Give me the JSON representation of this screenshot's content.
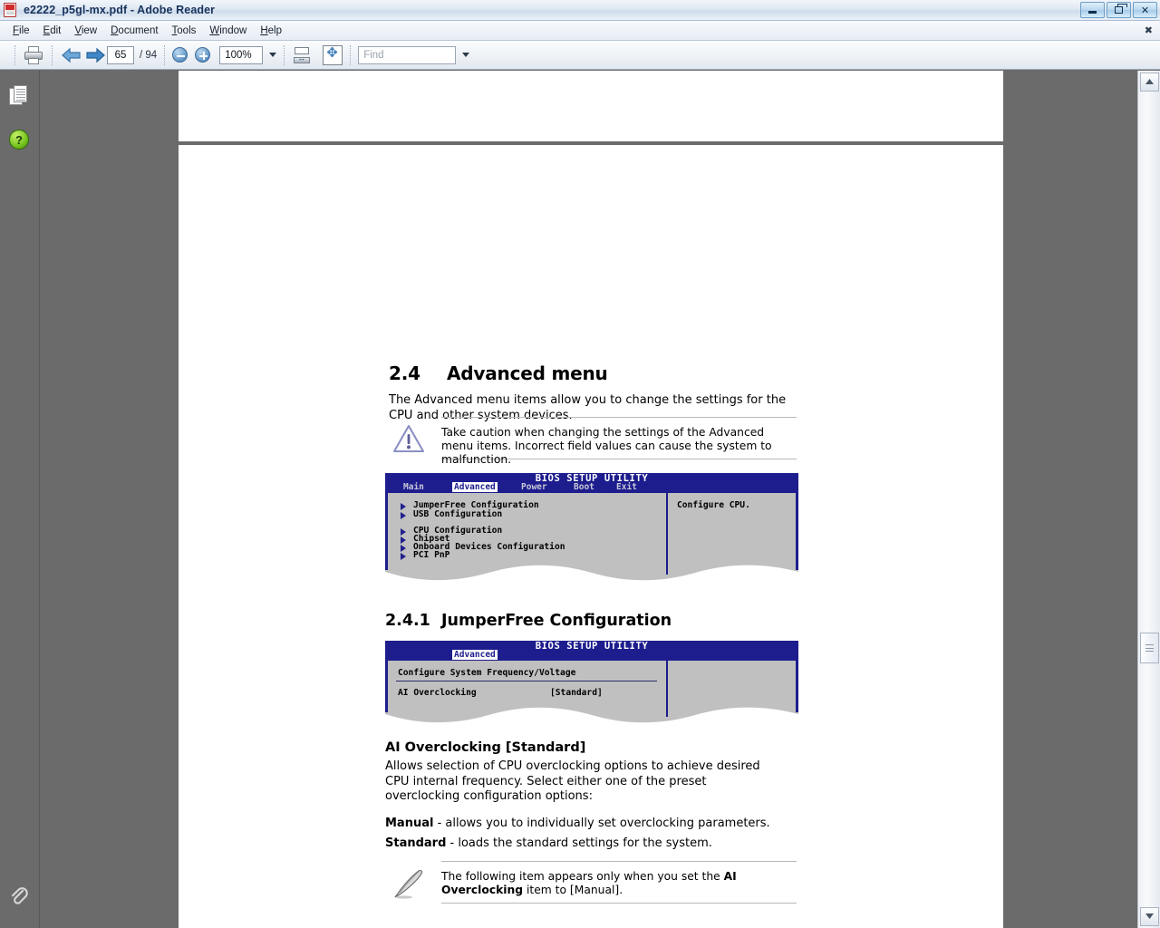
{
  "window": {
    "title": "e2222_p5gl-mx.pdf - Adobe Reader",
    "app_icon": "pdf-document-icon",
    "minimize_label": "",
    "restore_label": "",
    "close_label": "✕",
    "menubar_close_label": "✖"
  },
  "menubar": {
    "items": [
      {
        "acc": "F",
        "rest": "ile"
      },
      {
        "acc": "E",
        "rest": "dit"
      },
      {
        "acc": "V",
        "rest": "iew"
      },
      {
        "acc": "D",
        "rest": "ocument"
      },
      {
        "acc": "T",
        "rest": "ools"
      },
      {
        "acc": "W",
        "rest": "indow"
      },
      {
        "acc": "H",
        "rest": "elp"
      }
    ]
  },
  "toolbar": {
    "print_label": "print-icon",
    "prev_label": "previous-page-icon",
    "next_label": "next-page-icon",
    "page_number": "65",
    "page_total": "/ 94",
    "zoom_out_label": "zoom-out-icon",
    "zoom_in_label": "zoom-in-icon",
    "zoom_value": "100%",
    "fit_width_label": "fit-width-icon",
    "fit_page_label": "fit-page-icon",
    "find_placeholder": "Find",
    "find_value": ""
  },
  "leftpane": {
    "pages_label": "pages-panel-icon",
    "help_label": "?",
    "attachments_label": "attachments-icon"
  },
  "document": {
    "section": {
      "number": "2.4",
      "title": "Advanced menu",
      "intro": "The Advanced menu items allow you to change the settings for the CPU and other system devices."
    },
    "caution": {
      "icon": "warning-triangle-icon",
      "text": "Take caution when changing the settings of the Advanced menu items. Incorrect field values can cause the system to malfunction."
    },
    "bios_advanced": {
      "header_title": "BIOS SETUP UTILITY",
      "tabs": [
        "Main",
        "Advanced",
        "Power",
        "Boot",
        "Exit"
      ],
      "selected_tab": "Advanced",
      "menu_items": [
        "JumperFree Configuration",
        "USB Configuration",
        "CPU Configuration",
        "Chipset",
        "Onboard Devices Configuration",
        "PCI PnP"
      ],
      "help_text": "Configure CPU."
    },
    "subsection": {
      "number": "2.4.1",
      "title": "JumperFree Configuration"
    },
    "bios_jumperfree": {
      "header_title": "BIOS SETUP UTILITY",
      "tabs": [
        "Advanced"
      ],
      "selected_tab": "Advanced",
      "group_title": "Configure System Frequency/Voltage",
      "field_label": "AI Overclocking",
      "field_value": "[Standard]"
    },
    "ai_overclocking": {
      "heading": "AI Overclocking [Standard]",
      "body": "Allows selection of CPU overclocking options to achieve desired CPU internal frequency. Select either one of the preset overclocking configuration options:",
      "options": [
        {
          "name": "Manual",
          "desc": " - allows you to individually set overclocking parameters."
        },
        {
          "name": "Standard",
          "desc": " - loads the standard settings for the system."
        }
      ]
    },
    "note": {
      "icon": "pen-note-icon",
      "text_before": "The following item appears only when you set the ",
      "text_bold": "AI Overclocking",
      "text_after": " item to [Manual]."
    }
  },
  "scrollbar": {
    "up_label": "▲",
    "down_label": "▼",
    "thumb_label": "scrollbar-thumb"
  },
  "colors": {
    "bios_blue": "#1d1d8e",
    "bios_gray": "#c0c0c0",
    "viewport_gray": "#6b6b6b",
    "title_blue": "#16325c"
  }
}
